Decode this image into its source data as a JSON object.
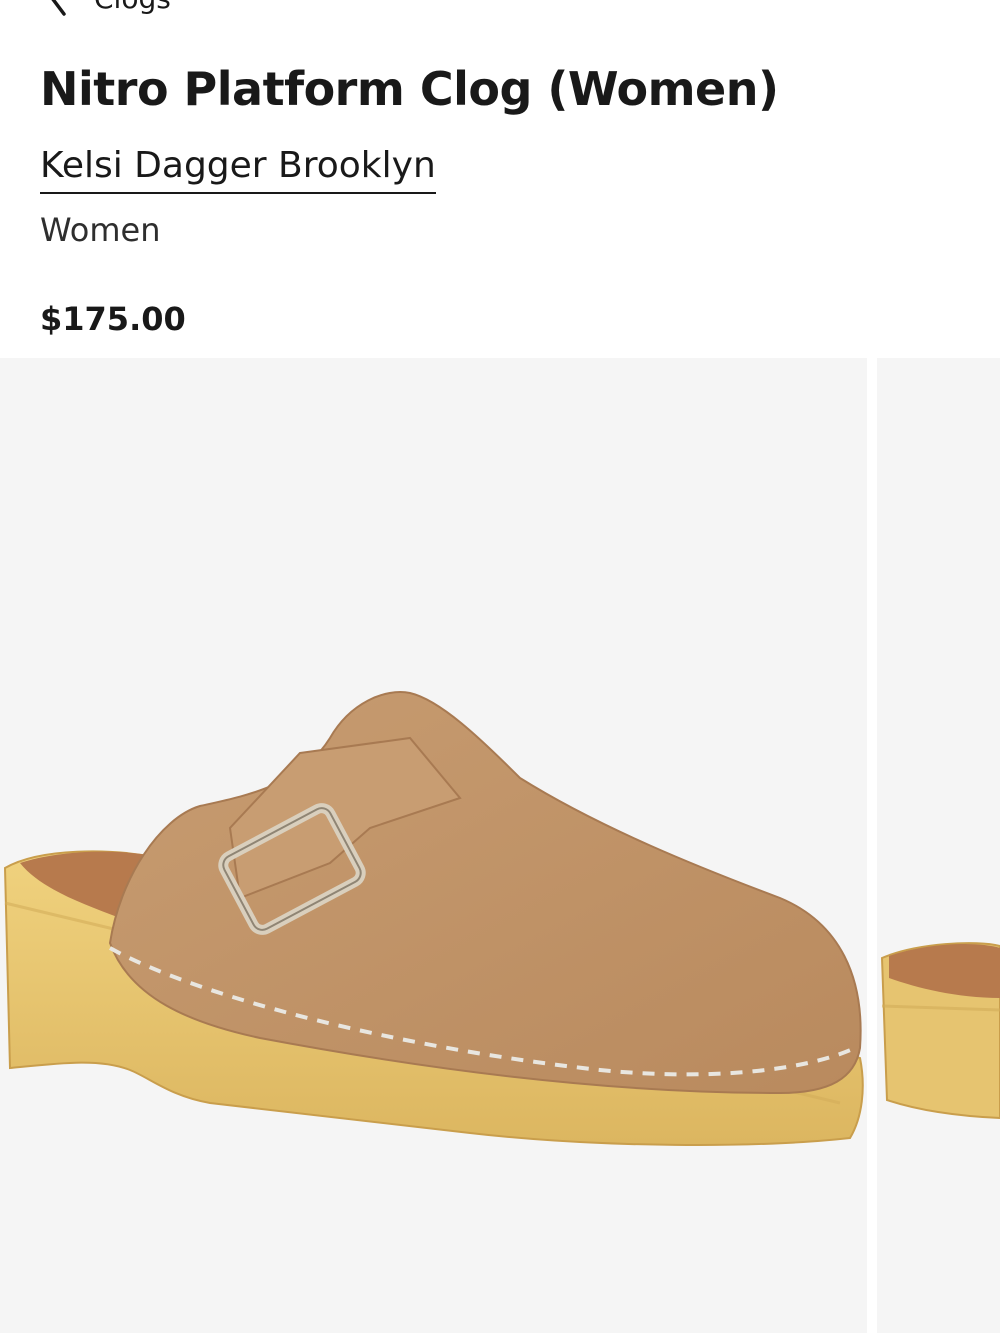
{
  "nav": {
    "back_label": "Clogs",
    "back_icon": "chevron-left-icon"
  },
  "product": {
    "title": "Nitro Platform Clog (Women)",
    "brand": "Kelsi Dagger Brooklyn",
    "department": "Women",
    "price": "$175.00"
  },
  "gallery": {
    "images": [
      {
        "subject": "tan leather clog with buckle strap on natural wood platform"
      },
      {
        "subject": "partial view of next product photo"
      }
    ]
  },
  "colors": {
    "leather": "#c49a70",
    "wood": "#e6c470",
    "background": "#f5f5f5",
    "text": "#191919"
  }
}
